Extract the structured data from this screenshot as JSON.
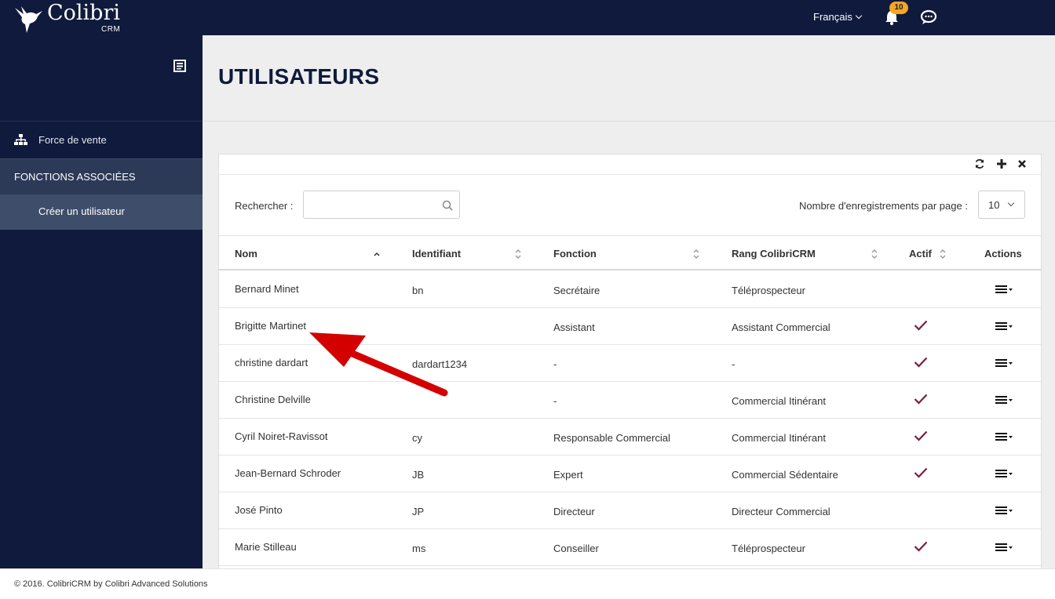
{
  "app": {
    "logo_text": "Colibri",
    "logo_sub": "CRM",
    "language": "Français",
    "notification_count": "10"
  },
  "sidebar": {
    "items": [
      {
        "label": "Force de vente",
        "icon": "sitemap-icon"
      }
    ],
    "section_label": "FONCTIONS ASSOCIÉES",
    "sub_items": [
      {
        "label": "Créer un utilisateur"
      }
    ]
  },
  "page": {
    "title": "UTILISATEURS"
  },
  "table_controls": {
    "search_label": "Rechercher :",
    "search_value": "",
    "search_placeholder": "",
    "per_page_label": "Nombre d'enregistrements par page :",
    "per_page_value": "10"
  },
  "table": {
    "columns": [
      "Nom",
      "Identifiant",
      "Fonction",
      "Rang ColibriCRM",
      "Actif",
      "Actions"
    ],
    "rows": [
      {
        "nom": "Bernard Minet",
        "identifiant": "bn",
        "fonction": "Secrétaire",
        "rang": "Téléprospecteur",
        "actif": false
      },
      {
        "nom": "Brigitte Martinet",
        "identifiant": "",
        "fonction": "Assistant",
        "rang": "Assistant Commercial",
        "actif": true
      },
      {
        "nom": "christine dardart",
        "identifiant": "dardart1234",
        "fonction": "-",
        "rang": "-",
        "actif": true
      },
      {
        "nom": "Christine Delville",
        "identifiant": "",
        "fonction": "-",
        "rang": "Commercial Itinérant",
        "actif": true
      },
      {
        "nom": "Cyril Noiret-Ravissot",
        "identifiant": "cy",
        "fonction": "Responsable Commercial",
        "rang": "Commercial Itinérant",
        "actif": true
      },
      {
        "nom": "Jean-Bernard Schroder",
        "identifiant": "JB",
        "fonction": "Expert",
        "rang": "Commercial Sédentaire",
        "actif": true
      },
      {
        "nom": "José Pinto",
        "identifiant": "JP",
        "fonction": "Directeur",
        "rang": "Directeur Commercial",
        "actif": false
      },
      {
        "nom": "Marie Stilleau",
        "identifiant": "ms",
        "fonction": "Conseiller",
        "rang": "Téléprospecteur",
        "actif": true
      }
    ]
  },
  "footer": {
    "text": "© 2016. ColibriCRM by Colibri Advanced Solutions"
  },
  "colors": {
    "navy": "#0f1a3c",
    "check": "#7a1f3d",
    "badge": "#f5a623",
    "arrow": "#d40000"
  }
}
